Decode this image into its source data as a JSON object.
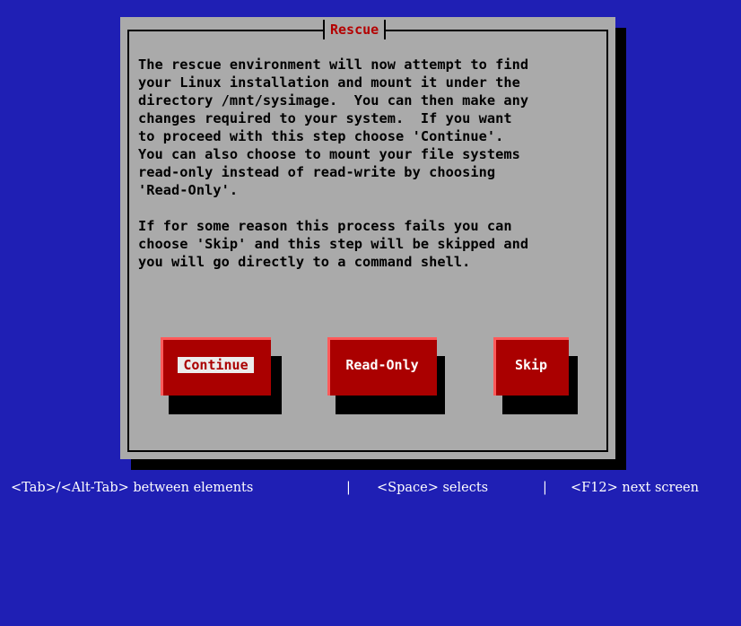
{
  "dialog": {
    "title": "Rescue",
    "body": "The rescue environment will now attempt to find\nyour Linux installation and mount it under the\ndirectory /mnt/sysimage.  You can then make any\nchanges required to your system.  If you want\nto proceed with this step choose 'Continue'.\nYou can also choose to mount your file systems\nread-only instead of read-write by choosing\n'Read-Only'.\n\nIf for some reason this process fails you can\nchoose 'Skip' and this step will be skipped and\nyou will go directly to a command shell."
  },
  "buttons": {
    "continue": "Continue",
    "read_only": "Read-Only",
    "skip": "Skip",
    "focused": "continue"
  },
  "statusbar": {
    "left": "<Tab>/<Alt-Tab> between elements",
    "sep1": "|",
    "middle": "<Space> selects",
    "sep2": "|",
    "right": "<F12> next screen"
  },
  "colors": {
    "background": "#1f1fb4",
    "dialog": "#aaaaaa",
    "button": "#aa0000",
    "title_text": "#b40000"
  }
}
